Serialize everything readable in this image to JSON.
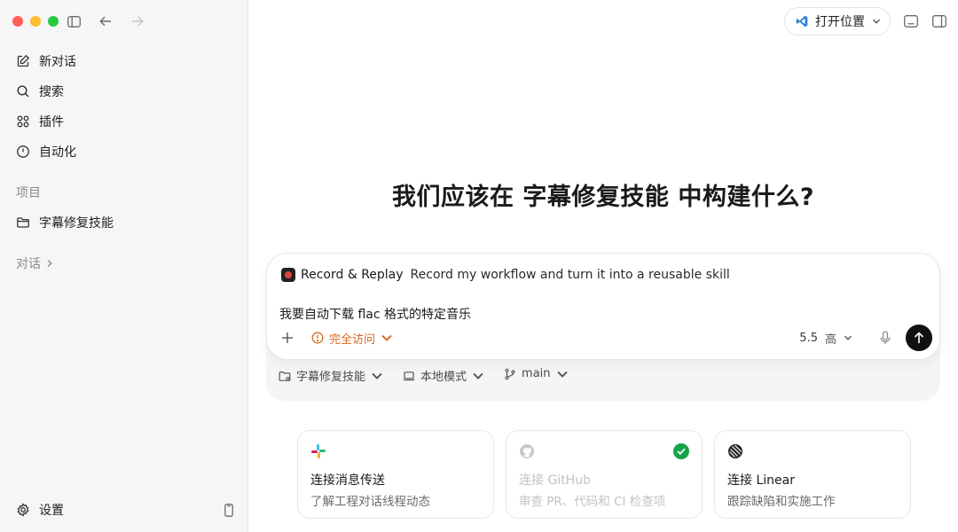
{
  "sidebar": {
    "nav": [
      {
        "label": "新对话",
        "icon": "compose-icon"
      },
      {
        "label": "搜索",
        "icon": "search-icon"
      },
      {
        "label": "插件",
        "icon": "grid-icon"
      },
      {
        "label": "自动化",
        "icon": "clock-icon"
      }
    ],
    "projects_label": "项目",
    "projects": [
      {
        "label": "字幕修复技能",
        "icon": "folder-icon"
      }
    ],
    "conversations_label": "对话",
    "settings_label": "设置"
  },
  "header": {
    "open_location_label": "打开位置"
  },
  "main": {
    "headline": "我们应该在 字幕修复技能 中构建什么?",
    "composer": {
      "skill_name": "Record & Replay",
      "skill_desc": "Record my workflow and turn it into a reusable skill",
      "prompt": "我要自动下载 flac 格式的特定音乐",
      "access_label": "完全访问",
      "model": "5.5",
      "effort": "高"
    },
    "sub_bar": {
      "project": "字幕修复技能",
      "mode": "本地模式",
      "branch": "main"
    },
    "cards": [
      {
        "title": "连接消息传送",
        "desc": "了解工程对话线程动态",
        "logo": "slack-icon",
        "connected": false
      },
      {
        "title": "连接 GitHub",
        "desc": "审查 PR、代码和 CI 检查项",
        "logo": "github-icon",
        "connected": true
      },
      {
        "title": "连接 Linear",
        "desc": "跟踪缺陷和实施工作",
        "logo": "linear-icon",
        "connected": false
      }
    ]
  },
  "colors": {
    "accent_orange": "#d9681e",
    "connected_green": "#17a34a",
    "sidebar_bg": "#f6f6f6"
  }
}
